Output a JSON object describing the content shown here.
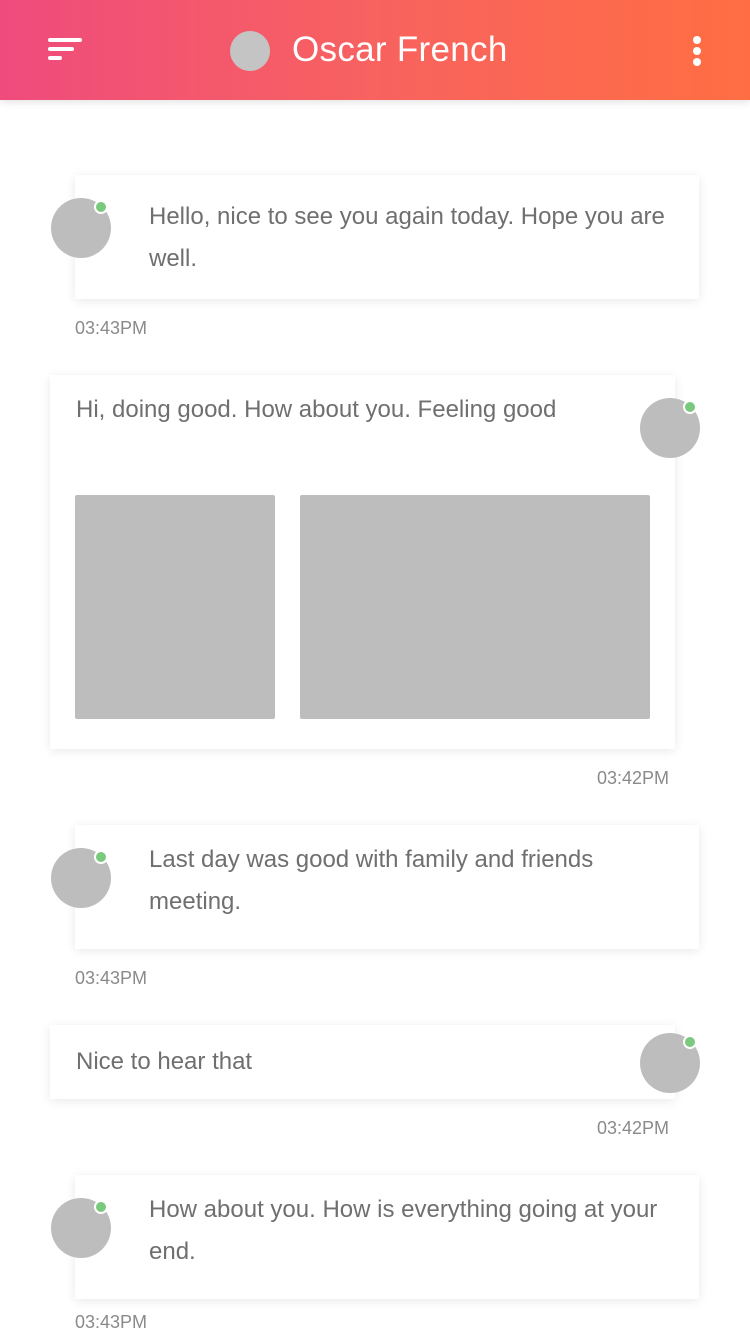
{
  "header": {
    "title": "Oscar French",
    "menu_icon": "menu-icon",
    "more_icon": "more-vertical-icon"
  },
  "colors": {
    "header_gradient_start": "#ef4b7d",
    "header_gradient_end": "#ff6e43",
    "online_dot": "#7ac97d",
    "placeholder_gray": "#bdbdbd"
  },
  "messages": [
    {
      "side": "incoming",
      "text": "Hello, nice to see you again today. Hope you are well.",
      "time": "03:43PM",
      "online": true
    },
    {
      "side": "outgoing",
      "text": "Hi, doing good. How about you. Feeling good",
      "time": "03:42PM",
      "online": true,
      "attachments": 2
    },
    {
      "side": "incoming",
      "text": "Last day was good with family and friends meeting.",
      "time": "03:43PM",
      "online": true
    },
    {
      "side": "outgoing",
      "text": "Nice to hear that",
      "time": "03:42PM",
      "online": true
    },
    {
      "side": "incoming",
      "text": "How about you. How is everything going at your end.",
      "time": "03:43PM",
      "online": true
    }
  ]
}
